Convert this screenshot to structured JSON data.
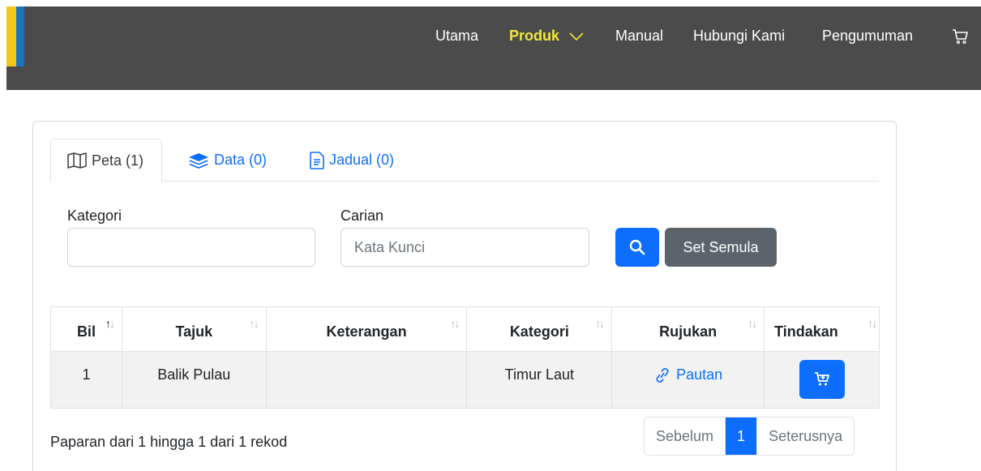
{
  "nav": {
    "items": [
      {
        "label": "Utama",
        "active": false
      },
      {
        "label": "Produk",
        "active": true,
        "has_dropdown": true
      },
      {
        "label": "Manual",
        "active": false
      },
      {
        "label": "Hubungi Kami",
        "active": false
      },
      {
        "label": "Pengumuman",
        "active": false
      }
    ],
    "cart_icon": "cart-icon"
  },
  "tabs": [
    {
      "label": "Peta (1)",
      "icon": "map-icon",
      "active": true
    },
    {
      "label": "Data (0)",
      "icon": "layers-icon",
      "active": false
    },
    {
      "label": "Jadual (0)",
      "icon": "document-icon",
      "active": false
    }
  ],
  "filters": {
    "kategori_label": "Kategori",
    "kategori_value": "",
    "carian_label": "Carian",
    "carian_placeholder": "Kata Kunci",
    "search_icon": "search-icon",
    "reset_label": "Set Semula"
  },
  "table": {
    "headers": [
      "Bil",
      "Tajuk",
      "Keterangan",
      "Kategori",
      "Rujukan",
      "Tindakan"
    ],
    "rows": [
      {
        "bil": "1",
        "tajuk": "Balik Pulau",
        "keterangan": "",
        "kategori": "Timur Laut",
        "rujukan": "Pautan",
        "tindakan_icon": "add-to-cart-icon"
      }
    ]
  },
  "footer": {
    "info": "Paparan dari 1 hingga 1 dari 1 rekod",
    "prev": "Sebelum",
    "current_page": "1",
    "next": "Seterusnya"
  },
  "colors": {
    "header_bg": "#4b4b4b",
    "nav_active": "#f3e73a",
    "primary": "#0d6efd",
    "secondary": "#5c636a",
    "logo_yellow": "#f5c518",
    "logo_blue": "#1e73be"
  }
}
